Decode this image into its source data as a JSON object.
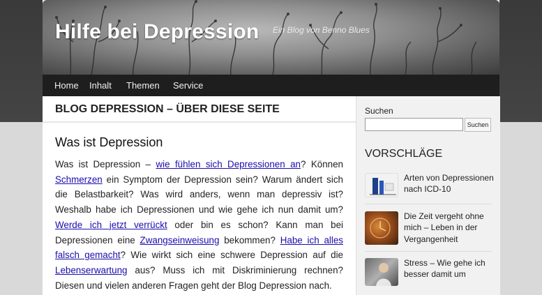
{
  "site": {
    "title": "Hilfe bei Depression",
    "description": "Ein Blog von Benno Blues"
  },
  "nav": {
    "items": [
      "Home",
      "Inhalt",
      "Themen",
      "Service"
    ]
  },
  "main": {
    "page_title": "BLOG DEPRESSION – ÜBER DIESE SEITE",
    "section_title": "Was ist Depression",
    "paragraph": [
      "Was ist Depression – ",
      "wie fühlen sich Depressionen an",
      "? Können ",
      "Schmerzen",
      " ein Symptom der Depression sein? Warum ändert sich die Belastbarkeit? Was wird anders, wenn man depressiv ist? Weshalb habe ich Depressionen und wie gehe ich nun damit um? ",
      "Werde ich jetzt verrückt",
      " oder bin es schon? Kann man bei Depressionen eine ",
      "Zwangseinweisung",
      " bekommen? ",
      "Habe ich alles falsch gemacht",
      "? Wie wirkt sich eine schwere Depression auf die ",
      "Lebenserwartung",
      " aus? Muss ich mit Diskriminierung rechnen? Diesen und vielen anderen Fragen geht der Blog Depression nach."
    ]
  },
  "sidebar": {
    "search_label": "Suchen",
    "search_value": "",
    "search_button": "Suchen",
    "widget_title": "VORSCHLÄGE",
    "posts": [
      {
        "title": "Arten von Depressionen nach ICD-10"
      },
      {
        "title": "Die Zeit vergeht ohne mich – Leben in der Vergangenheit"
      },
      {
        "title": "Stress – Wie gehe ich besser damit um"
      }
    ]
  }
}
